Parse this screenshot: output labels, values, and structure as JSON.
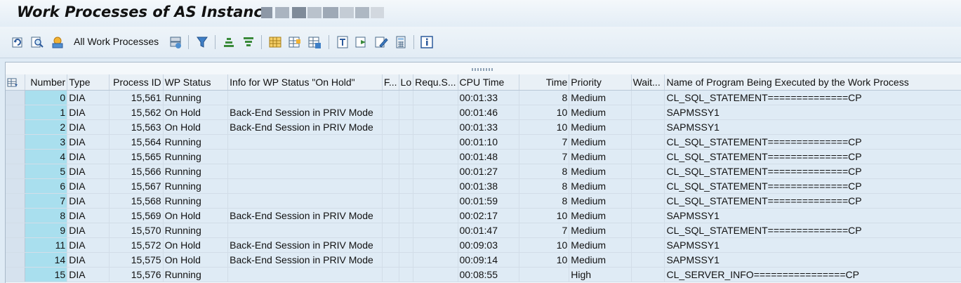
{
  "title": "Work Processes of AS Instance",
  "toolbar": {
    "all_work_processes_label": "All Work Processes",
    "icons": [
      "refresh-icon",
      "details-icon",
      "cpu-icon",
      "all-processes-icon",
      "restart-icon",
      "filter-icon",
      "sort-ascending-icon",
      "sort-descending-icon",
      "layout-icon",
      "columns-icon",
      "export-icon",
      "print-icon",
      "spreadsheet-icon",
      "edit-icon",
      "calculator-icon",
      "info-icon"
    ]
  },
  "columns": [
    "Number",
    "Type",
    "Process ID",
    "WP Status",
    "Info for WP Status \"On Hold\"",
    "F...",
    "Lo",
    "Requ.S...",
    "CPU Time",
    "Time",
    "Priority",
    "Wait...",
    "Name of Program Being Executed by the Work Process"
  ],
  "rows": [
    {
      "number": "0",
      "type": "DIA",
      "pid": "15,561",
      "status": "Running",
      "info": "",
      "cpu": "00:01:33",
      "time": "8",
      "priority": "Medium",
      "program": "CL_SQL_STATEMENT==============CP"
    },
    {
      "number": "1",
      "type": "DIA",
      "pid": "15,562",
      "status": "On Hold",
      "info": "Back-End Session in PRIV Mode",
      "cpu": "00:01:46",
      "time": "10",
      "priority": "Medium",
      "program": "SAPMSSY1"
    },
    {
      "number": "2",
      "type": "DIA",
      "pid": "15,563",
      "status": "On Hold",
      "info": "Back-End Session in PRIV Mode",
      "cpu": "00:01:33",
      "time": "10",
      "priority": "Medium",
      "program": "SAPMSSY1"
    },
    {
      "number": "3",
      "type": "DIA",
      "pid": "15,564",
      "status": "Running",
      "info": "",
      "cpu": "00:01:10",
      "time": "7",
      "priority": "Medium",
      "program": "CL_SQL_STATEMENT==============CP"
    },
    {
      "number": "4",
      "type": "DIA",
      "pid": "15,565",
      "status": "Running",
      "info": "",
      "cpu": "00:01:48",
      "time": "7",
      "priority": "Medium",
      "program": "CL_SQL_STATEMENT==============CP"
    },
    {
      "number": "5",
      "type": "DIA",
      "pid": "15,566",
      "status": "Running",
      "info": "",
      "cpu": "00:01:27",
      "time": "8",
      "priority": "Medium",
      "program": "CL_SQL_STATEMENT==============CP"
    },
    {
      "number": "6",
      "type": "DIA",
      "pid": "15,567",
      "status": "Running",
      "info": "",
      "cpu": "00:01:38",
      "time": "8",
      "priority": "Medium",
      "program": "CL_SQL_STATEMENT==============CP"
    },
    {
      "number": "7",
      "type": "DIA",
      "pid": "15,568",
      "status": "Running",
      "info": "",
      "cpu": "00:01:59",
      "time": "8",
      "priority": "Medium",
      "program": "CL_SQL_STATEMENT==============CP"
    },
    {
      "number": "8",
      "type": "DIA",
      "pid": "15,569",
      "status": "On Hold",
      "info": "Back-End Session in PRIV Mode",
      "cpu": "00:02:17",
      "time": "10",
      "priority": "Medium",
      "program": "SAPMSSY1"
    },
    {
      "number": "9",
      "type": "DIA",
      "pid": "15,570",
      "status": "Running",
      "info": "",
      "cpu": "00:01:47",
      "time": "7",
      "priority": "Medium",
      "program": "CL_SQL_STATEMENT==============CP"
    },
    {
      "number": "11",
      "type": "DIA",
      "pid": "15,572",
      "status": "On Hold",
      "info": "Back-End Session in PRIV Mode",
      "cpu": "00:09:03",
      "time": "10",
      "priority": "Medium",
      "program": "SAPMSSY1"
    },
    {
      "number": "14",
      "type": "DIA",
      "pid": "15,575",
      "status": "On Hold",
      "info": "Back-End Session in PRIV Mode",
      "cpu": "00:09:14",
      "time": "10",
      "priority": "Medium",
      "program": "SAPMSSY1"
    },
    {
      "number": "15",
      "type": "DIA",
      "pid": "15,576",
      "status": "Running",
      "info": "",
      "cpu": "00:08:55",
      "time": "",
      "priority": "High",
      "program": "CL_SERVER_INFO================CP"
    }
  ]
}
